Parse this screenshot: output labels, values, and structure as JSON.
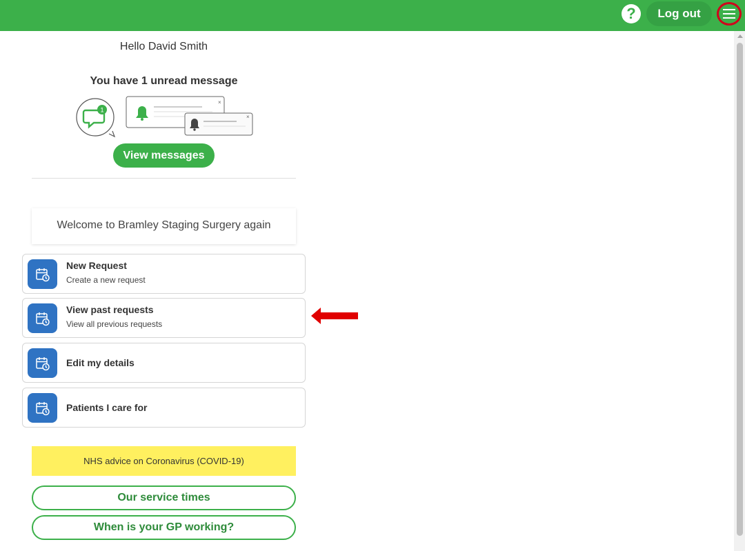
{
  "header": {
    "help_label": "?",
    "logout_label": "Log out",
    "menu_icon": "hamburger-menu-icon",
    "accent_color": "#3cb04a"
  },
  "messages": {
    "greeting": "Hello David Smith",
    "unread_text": "You have 1 unread message",
    "badge_count": "1",
    "view_messages_label": "View messages"
  },
  "welcome_text": "Welcome to Bramley Staging Surgery again",
  "actions": [
    {
      "title": "New Request",
      "subtitle": "Create a new request",
      "icon": "calendar-clock-icon"
    },
    {
      "title": "View past requests",
      "subtitle": "View all previous requests",
      "icon": "calendar-clock-icon"
    },
    {
      "title": "Edit my details",
      "subtitle": "",
      "icon": "calendar-clock-icon"
    },
    {
      "title": "Patients I care for",
      "subtitle": "",
      "icon": "calendar-clock-icon"
    }
  ],
  "covid_link": "NHS advice on Coronavirus (COVID-19)",
  "service_times_label": "Our service times",
  "gp_working_label": "When is your GP working?",
  "colors": {
    "header_green": "#3cb04a",
    "card_icon_blue": "#2f73c3",
    "covid_yellow": "#fff05f",
    "annotation_red": "#e00000"
  }
}
